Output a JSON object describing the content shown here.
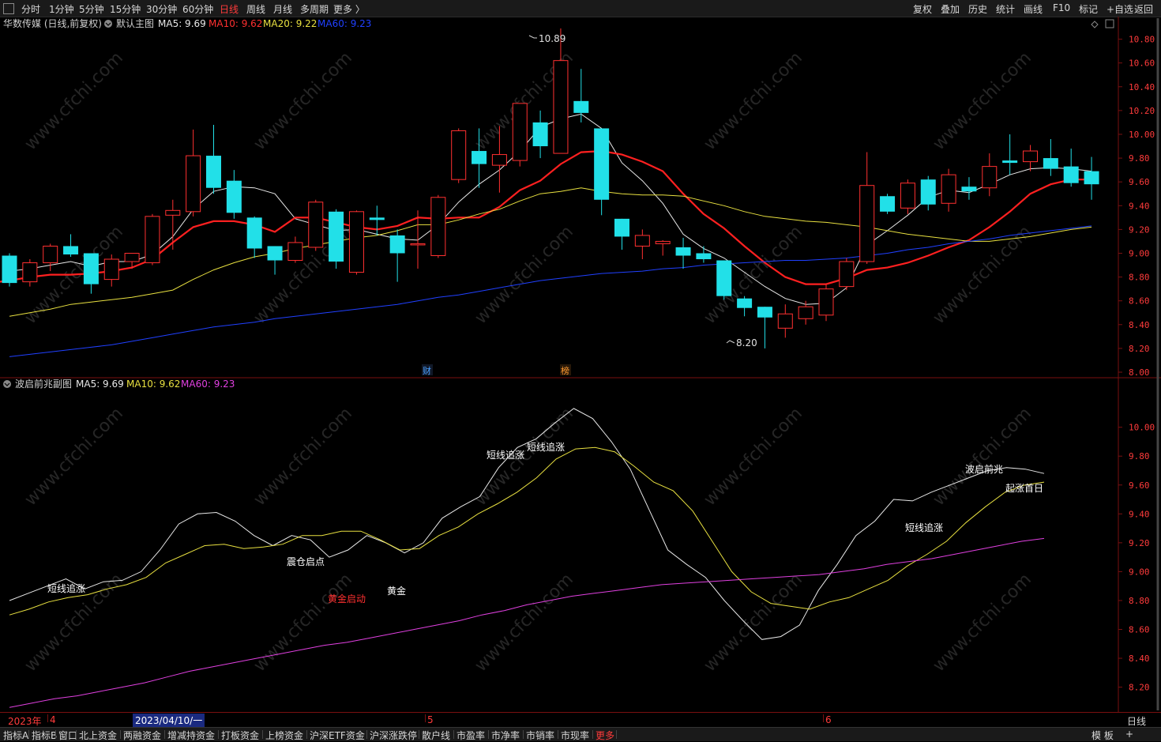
{
  "toolbar": {
    "periods": [
      "分时",
      "1分钟",
      "5分钟",
      "15分钟",
      "30分钟",
      "60分钟",
      "日线",
      "周线",
      "月线",
      "多周期",
      "更多 〉"
    ],
    "active_period": "日线",
    "right_buttons": [
      "复权",
      "叠加",
      "历史",
      "统计",
      "画线",
      "F10",
      "标记",
      "+自选",
      "返回"
    ]
  },
  "main_chart": {
    "title": "华数传媒 (日线,前复权)",
    "template": "默认主图",
    "ma_legend": [
      {
        "label": "MA5: 9.69",
        "color": "#e8e8e8"
      },
      {
        "label": "MA10: 9.62",
        "color": "#ff3030"
      },
      {
        "label": "MA20: 9.22",
        "color": "#e8e040"
      },
      {
        "label": "MA60: 9.23",
        "color": "#2040ff"
      }
    ],
    "high_label": "10.89",
    "low_label": "8.20",
    "markers": [
      {
        "text": "财",
        "color": "#4aa0ff"
      },
      {
        "text": "榜",
        "color": "#ff9a30"
      }
    ]
  },
  "sub_chart": {
    "title": "波启前兆副图",
    "ma_legend": [
      {
        "label": "MA5: 9.69",
        "color": "#e8e8e8"
      },
      {
        "label": "MA10: 9.62",
        "color": "#e8e040"
      },
      {
        "label": "MA60: 9.23",
        "color": "#e040e0"
      }
    ],
    "annotations": [
      {
        "text": "短线追涨",
        "color": "#ffffff"
      },
      {
        "text": "震仓启点",
        "color": "#ffffff"
      },
      {
        "text": "黄金启动",
        "color": "#ff3030"
      },
      {
        "text": "黄金",
        "color": "#ffffff"
      },
      {
        "text": "短线追涨",
        "color": "#ffffff"
      },
      {
        "text": "短线追涨",
        "color": "#ffffff"
      },
      {
        "text": "短线追涨",
        "color": "#ffffff"
      },
      {
        "text": "波启前兆",
        "color": "#ffffff"
      },
      {
        "text": "起涨首日",
        "color": "#ffffff"
      }
    ]
  },
  "date_axis": {
    "year_label": "2023年",
    "cursor_date": "2023/04/10/一",
    "months": [
      "4",
      "5",
      "6"
    ],
    "period_label": "日线"
  },
  "watermark": "www.cfchi.com",
  "bottom_tabs": [
    "指标A",
    "指标B",
    "窗口",
    "北上资金",
    "两融资金",
    "增减持资金",
    "打板资金",
    "上榜资金",
    "沪深ETF资金",
    "沪深涨跌停",
    "散户线",
    "市盈率",
    "市净率",
    "市销率",
    "市现率",
    "更多"
  ],
  "bottom_right": [
    "模 板",
    "+"
  ],
  "chart_data": [
    {
      "type": "candlestick",
      "title": "华数传媒 (日线,前复权)",
      "ylim": [
        8.0,
        10.95
      ],
      "y_ticks": [
        "10.80",
        "10.60",
        "10.40",
        "10.20",
        "10.00",
        "9.80",
        "9.60",
        "9.40",
        "9.20",
        "9.00",
        "8.80",
        "8.60",
        "8.40",
        "8.20",
        "8.00"
      ],
      "candles": [
        [
          8.98,
          8.75,
          9.0,
          8.72
        ],
        [
          8.76,
          8.92,
          8.95,
          8.72
        ],
        [
          8.92,
          9.06,
          9.08,
          8.85
        ],
        [
          9.06,
          8.99,
          9.16,
          8.97
        ],
        [
          9.0,
          8.74,
          9.0,
          8.66
        ],
        [
          8.78,
          8.95,
          8.99,
          8.72
        ],
        [
          8.93,
          9.0,
          9.0,
          8.87
        ],
        [
          8.92,
          9.31,
          9.33,
          8.9
        ],
        [
          9.32,
          9.36,
          9.45,
          9.03
        ],
        [
          9.35,
          9.82,
          10.04,
          9.31
        ],
        [
          9.82,
          9.55,
          10.08,
          9.5
        ],
        [
          9.61,
          9.34,
          9.7,
          9.29
        ],
        [
          9.3,
          9.04,
          9.31,
          8.96
        ],
        [
          9.06,
          8.94,
          9.06,
          8.82
        ],
        [
          8.94,
          9.09,
          9.14,
          8.92
        ],
        [
          9.05,
          9.43,
          9.45,
          9.02
        ],
        [
          9.35,
          8.93,
          9.37,
          8.87
        ],
        [
          8.84,
          9.35,
          9.36,
          8.82
        ],
        [
          9.3,
          9.28,
          9.4,
          9.15
        ],
        [
          9.15,
          9.0,
          9.2,
          8.76
        ],
        [
          9.08,
          9.08,
          9.36,
          8.87
        ],
        [
          8.98,
          9.47,
          9.49,
          8.96
        ],
        [
          9.62,
          10.03,
          10.05,
          9.59
        ],
        [
          9.86,
          9.75,
          10.05,
          9.55
        ],
        [
          9.74,
          9.83,
          10.07,
          9.51
        ],
        [
          9.78,
          10.26,
          10.26,
          9.73
        ],
        [
          10.1,
          9.9,
          10.2,
          9.8
        ],
        [
          9.84,
          10.62,
          10.89,
          9.84
        ],
        [
          10.28,
          10.18,
          10.55,
          10.1
        ],
        [
          10.05,
          9.45,
          10.05,
          9.32
        ],
        [
          9.29,
          9.14,
          9.29,
          9.03
        ],
        [
          9.06,
          9.15,
          9.2,
          8.95
        ],
        [
          9.08,
          9.1,
          9.11,
          8.98
        ],
        [
          9.05,
          8.98,
          9.13,
          8.87
        ],
        [
          9.0,
          8.95,
          9.06,
          8.92
        ],
        [
          8.94,
          8.64,
          8.94,
          8.61
        ],
        [
          8.62,
          8.54,
          8.64,
          8.47
        ],
        [
          8.55,
          8.46,
          8.55,
          8.2
        ],
        [
          8.37,
          8.49,
          8.57,
          8.29
        ],
        [
          8.45,
          8.55,
          8.6,
          8.4
        ],
        [
          8.48,
          8.7,
          8.74,
          8.43
        ],
        [
          8.72,
          8.93,
          8.96,
          8.69
        ],
        [
          8.93,
          9.57,
          9.85,
          8.91
        ],
        [
          9.48,
          9.35,
          9.5,
          9.33
        ],
        [
          9.38,
          9.59,
          9.62,
          9.33
        ],
        [
          9.62,
          9.41,
          9.65,
          9.36
        ],
        [
          9.42,
          9.66,
          9.71,
          9.35
        ],
        [
          9.56,
          9.52,
          9.64,
          9.45
        ],
        [
          9.55,
          9.73,
          9.84,
          9.48
        ],
        [
          9.78,
          9.76,
          10.0,
          9.66
        ],
        [
          9.77,
          9.86,
          9.91,
          9.69
        ],
        [
          9.8,
          9.71,
          9.96,
          9.65
        ],
        [
          9.73,
          9.59,
          9.88,
          9.56
        ],
        [
          9.69,
          9.58,
          9.81,
          9.45
        ]
      ],
      "series": [
        {
          "name": "MA5",
          "values": [
            8.85,
            8.87,
            8.9,
            8.93,
            8.89,
            8.93,
            8.93,
            8.99,
            9.14,
            9.37,
            9.52,
            9.56,
            9.55,
            9.5,
            9.29,
            9.24,
            9.19,
            9.2,
            9.16,
            9.12,
            9.11,
            9.24,
            9.43,
            9.58,
            9.7,
            9.86,
            10.06,
            10.13,
            10.17,
            10.05,
            9.76,
            9.61,
            9.42,
            9.16,
            9.04,
            8.96,
            8.84,
            8.72,
            8.62,
            8.57,
            8.58,
            8.71,
            9.07,
            9.19,
            9.32,
            9.47,
            9.53,
            9.51,
            9.58,
            9.66,
            9.71,
            9.72,
            9.71,
            9.69
          ]
        },
        {
          "name": "MA10",
          "values": [
            8.75,
            8.77,
            8.8,
            8.82,
            8.82,
            8.83,
            8.85,
            8.88,
            8.95,
            9.09,
            9.22,
            9.27,
            9.27,
            9.24,
            9.18,
            9.3,
            9.3,
            9.26,
            9.22,
            9.2,
            9.23,
            9.3,
            9.29,
            9.3,
            9.3,
            9.39,
            9.53,
            9.61,
            9.75,
            9.85,
            9.86,
            9.83,
            9.77,
            9.69,
            9.5,
            9.33,
            9.21,
            9.06,
            8.92,
            8.8,
            8.74,
            8.74,
            8.79,
            8.86,
            8.88,
            8.92,
            8.98,
            9.05,
            9.11,
            9.22,
            9.35,
            9.5,
            9.58,
            9.62,
            9.62
          ]
        },
        {
          "name": "MA20",
          "values": [
            8.47,
            8.5,
            8.53,
            8.57,
            8.59,
            8.61,
            8.63,
            8.66,
            8.69,
            8.78,
            8.86,
            8.92,
            8.97,
            9.0,
            9.04,
            9.07,
            9.1,
            9.13,
            9.15,
            9.19,
            9.24,
            9.24,
            9.28,
            9.33,
            9.37,
            9.44,
            9.5,
            9.52,
            9.55,
            9.52,
            9.5,
            9.49,
            9.49,
            9.48,
            9.44,
            9.4,
            9.35,
            9.31,
            9.29,
            9.27,
            9.26,
            9.24,
            9.22,
            9.19,
            9.16,
            9.14,
            9.12,
            9.1,
            9.1,
            9.12,
            9.14,
            9.17,
            9.2,
            9.22
          ]
        },
        {
          "name": "MA60",
          "values": [
            8.13,
            8.15,
            8.17,
            8.19,
            8.21,
            8.23,
            8.26,
            8.29,
            8.32,
            8.35,
            8.38,
            8.4,
            8.42,
            8.45,
            8.47,
            8.49,
            8.51,
            8.53,
            8.55,
            8.57,
            8.6,
            8.63,
            8.65,
            8.68,
            8.71,
            8.74,
            8.77,
            8.79,
            8.81,
            8.83,
            8.84,
            8.85,
            8.87,
            8.88,
            8.9,
            8.91,
            8.92,
            8.93,
            8.94,
            8.94,
            8.95,
            8.96,
            8.98,
            9.0,
            9.03,
            9.05,
            9.08,
            9.1,
            9.12,
            9.15,
            9.17,
            9.19,
            9.21,
            9.23
          ]
        }
      ]
    },
    {
      "type": "line",
      "title": "波启前兆副图",
      "ylim": [
        8.05,
        10.25
      ],
      "y_ticks": [
        "10.00",
        "9.80",
        "9.60",
        "9.40",
        "9.20",
        "9.00",
        "8.80",
        "8.60",
        "8.40",
        "8.20"
      ],
      "series": [
        {
          "name": "MA5",
          "values": [
            8.8,
            8.85,
            8.9,
            8.95,
            8.88,
            8.93,
            8.94,
            9.0,
            9.15,
            9.33,
            9.4,
            9.41,
            9.35,
            9.25,
            9.18,
            9.25,
            9.22,
            9.1,
            9.15,
            9.25,
            9.2,
            9.13,
            9.2,
            9.37,
            9.45,
            9.52,
            9.72,
            9.86,
            9.92,
            10.03,
            10.13,
            10.06,
            9.9,
            9.71,
            9.43,
            9.15,
            9.05,
            8.96,
            8.8,
            8.66,
            8.53,
            8.55,
            8.63,
            8.87,
            9.05,
            9.25,
            9.35,
            9.5,
            9.49,
            9.55,
            9.6,
            9.65,
            9.7,
            9.72,
            9.71,
            9.68
          ]
        },
        {
          "name": "MA10",
          "values": [
            8.7,
            8.74,
            8.79,
            8.82,
            8.84,
            8.88,
            8.91,
            8.96,
            9.06,
            9.12,
            9.18,
            9.19,
            9.16,
            9.17,
            9.19,
            9.25,
            9.25,
            9.28,
            9.28,
            9.22,
            9.15,
            9.16,
            9.25,
            9.31,
            9.4,
            9.47,
            9.55,
            9.65,
            9.78,
            9.85,
            9.86,
            9.83,
            9.73,
            9.62,
            9.56,
            9.42,
            9.21,
            9.0,
            8.86,
            8.78,
            8.76,
            8.74,
            8.79,
            8.82,
            8.88,
            8.94,
            9.04,
            9.12,
            9.21,
            9.34,
            9.45,
            9.55,
            9.6,
            9.62
          ]
        },
        {
          "name": "MA60",
          "values": [
            8.06,
            8.09,
            8.12,
            8.14,
            8.17,
            8.2,
            8.23,
            8.27,
            8.31,
            8.34,
            8.37,
            8.4,
            8.43,
            8.46,
            8.49,
            8.51,
            8.54,
            8.57,
            8.6,
            8.63,
            8.66,
            8.7,
            8.73,
            8.77,
            8.8,
            8.83,
            8.85,
            8.87,
            8.89,
            8.91,
            8.92,
            8.93,
            8.94,
            8.95,
            8.96,
            8.97,
            8.98,
            9.0,
            9.02,
            9.05,
            9.07,
            9.09,
            9.12,
            9.15,
            9.18,
            9.21,
            9.23
          ]
        }
      ]
    }
  ]
}
